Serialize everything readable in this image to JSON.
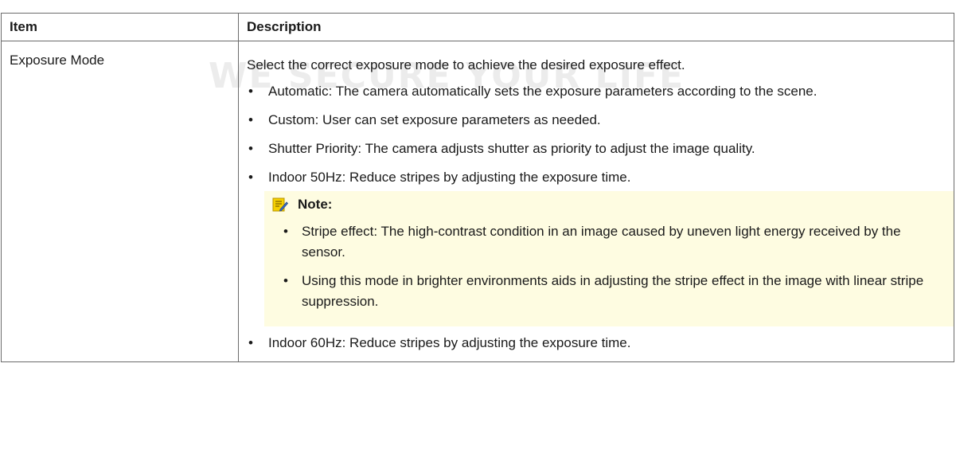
{
  "table": {
    "header_item": "Item",
    "header_description": "Description",
    "row": {
      "item": "Exposure Mode",
      "intro": "Select the correct exposure mode to achieve the desired exposure effect.",
      "options": [
        "Automatic: The camera automatically sets the exposure parameters according to the scene.",
        "Custom: User can set exposure parameters as needed.",
        "Shutter Priority: The camera adjusts shutter as priority to adjust the image quality.",
        "Indoor 50Hz: Reduce stripes by adjusting the exposure time."
      ],
      "note": {
        "label": "Note:",
        "icon": "note-pencil-icon",
        "items": [
          "Stripe effect: The high-contrast condition in an image caused by uneven light energy received by the sensor.",
          "Using this mode in brighter environments aids in adjusting the stripe effect in the image with linear stripe suppression."
        ]
      },
      "options_after_note": [
        "Indoor 60Hz: Reduce stripes by adjusting the exposure time."
      ]
    }
  },
  "watermark": {
    "text": "WE SECURE YOUR LIFE"
  },
  "colors": {
    "note_background": "#fefce1",
    "border": "#6b6b6b",
    "note_icon": "#f2c200"
  }
}
